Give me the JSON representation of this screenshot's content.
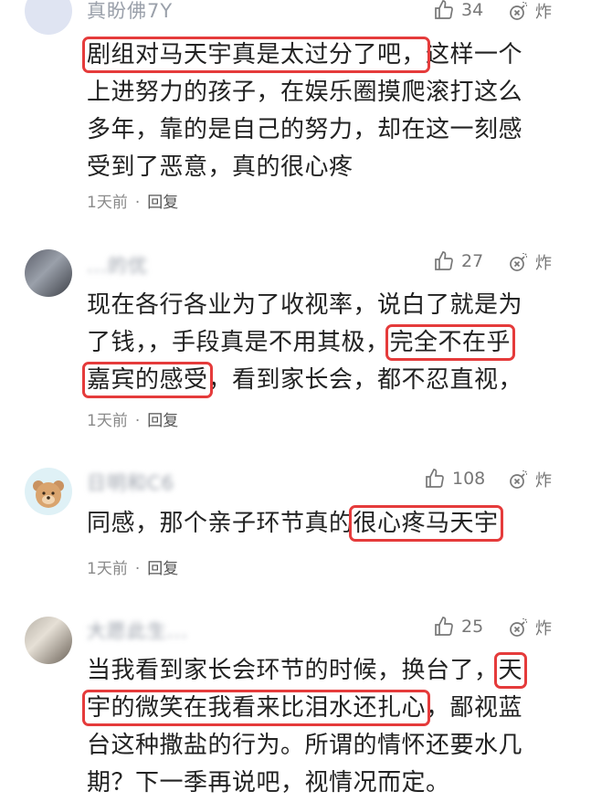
{
  "comments": [
    {
      "username": "真盼佛7Y",
      "likes": "34",
      "bomb": "炸",
      "lines": [
        {
          "pre": "",
          "hl": "剧组对马天宇真是太过分了吧，",
          "post": "这样一个"
        },
        {
          "pre": "上进努力的孩子，在娱乐圈摸爬滚打这么",
          "hl": "",
          "post": ""
        },
        {
          "pre": "多年，靠的是自己的努力，却在这一刻感",
          "hl": "",
          "post": ""
        },
        {
          "pre": "受到了恶意，真的很心疼",
          "hl": "",
          "post": ""
        }
      ],
      "time": "1天前",
      "reply": "回复"
    },
    {
      "username": "...的优",
      "likes": "27",
      "bomb": "炸",
      "lines": [
        {
          "pre": "现在各行各业为了收视率，说白了就是为",
          "hl": "",
          "post": ""
        },
        {
          "pre": "了钱，，手段真是不用其极，",
          "hl": "完全不在乎",
          "post": ""
        },
        {
          "pre": "",
          "hl": "嘉宾的感受",
          "post": "，看到家长会，都不忍直视，"
        }
      ],
      "time": "1天前",
      "reply": "回复"
    },
    {
      "username": "日明和C6",
      "likes": "108",
      "bomb": "炸",
      "lines": [
        {
          "pre": "同感，那个亲子环节真的",
          "hl": "很心疼马天宇",
          "post": ""
        }
      ],
      "time": "1天前",
      "reply": "回复"
    },
    {
      "username": "大愿此生...",
      "likes": "25",
      "bomb": "炸",
      "lines": [
        {
          "pre": "当我看到家长会环节的时候，换台了，",
          "hl": "天",
          "post": ""
        },
        {
          "pre": "",
          "hl": "宇的微笑在我看来比泪水还扎心",
          "post": "，鄙视蓝"
        },
        {
          "pre": "台这种撒盐的行为。所谓的情怀还要水几",
          "hl": "",
          "post": ""
        },
        {
          "pre": "期？下一季再说吧，视情况而定。",
          "hl": "",
          "post": ""
        }
      ]
    }
  ],
  "colors": {
    "highlight": "#e53b3b",
    "meta": "#8a8a8a"
  },
  "icons": {
    "like": "thumbs-up-icon",
    "bomb": "bomb-icon"
  }
}
